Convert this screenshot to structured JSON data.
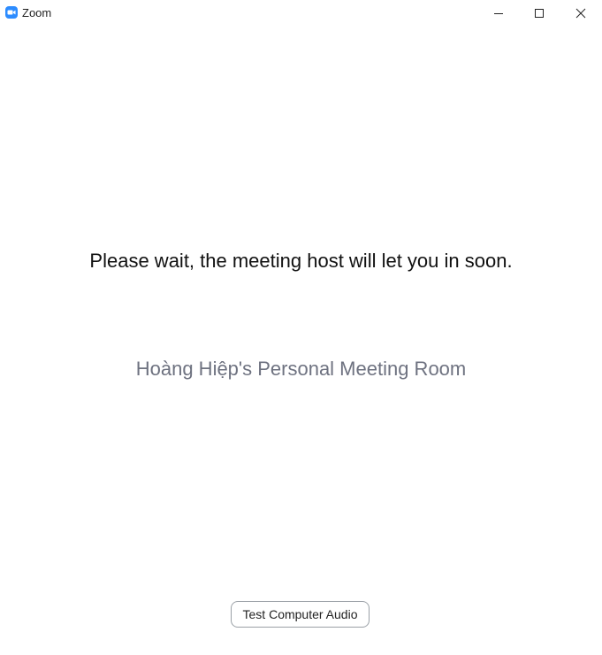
{
  "window": {
    "title": "Zoom",
    "logo_icon": "zoom-camera-icon",
    "controls": {
      "minimize_icon": "minimize-icon",
      "maximize_icon": "maximize-icon",
      "close_icon": "close-icon"
    }
  },
  "main": {
    "wait_message": "Please wait, the meeting host will let you in soon.",
    "room_name": "Hoàng Hiệp's Personal Meeting Room"
  },
  "footer": {
    "test_audio_label": "Test Computer Audio"
  },
  "colors": {
    "brand": "#2d8cff",
    "room_name_text": "#6e7280"
  }
}
